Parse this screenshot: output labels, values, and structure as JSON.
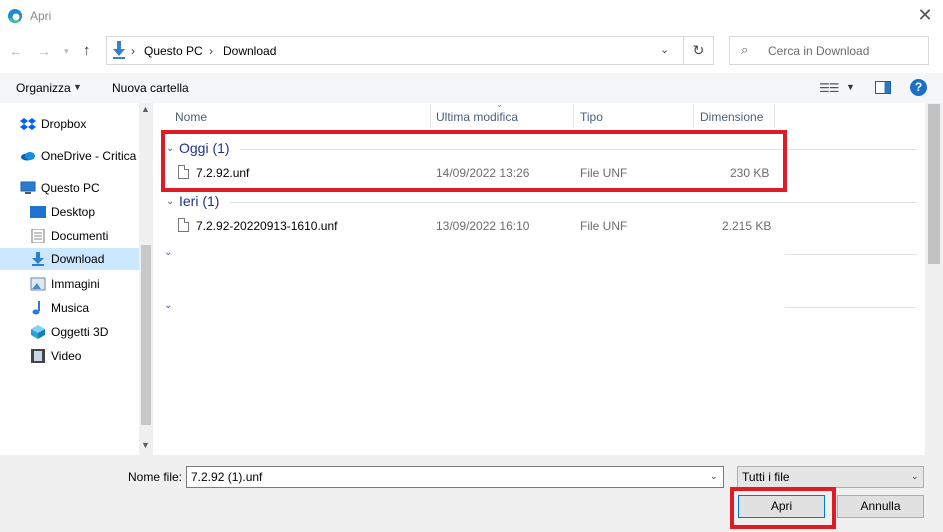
{
  "window": {
    "title": "Apri"
  },
  "address": {
    "segments": [
      "Questo PC",
      "Download"
    ],
    "separator": "›"
  },
  "search": {
    "placeholder": "Cerca in Download"
  },
  "toolbar": {
    "organize": "Organizza",
    "new_folder": "Nuova cartella"
  },
  "nav": {
    "items": [
      {
        "label": "Dropbox",
        "icon": "dropbox-icon"
      },
      {
        "label": "OneDrive - Critica",
        "icon": "onedrive-icon"
      },
      {
        "label": "Questo PC",
        "icon": "computer-icon"
      },
      {
        "label": "Desktop",
        "icon": "desktop-icon"
      },
      {
        "label": "Documenti",
        "icon": "documents-icon"
      },
      {
        "label": "Download",
        "icon": "download-icon",
        "selected": true
      },
      {
        "label": "Immagini",
        "icon": "pictures-icon"
      },
      {
        "label": "Musica",
        "icon": "music-icon"
      },
      {
        "label": "Oggetti 3D",
        "icon": "objects-3d-icon"
      },
      {
        "label": "Video",
        "icon": "video-icon"
      }
    ]
  },
  "columns": {
    "name": "Nome",
    "modified": "Ultima modifica",
    "type": "Tipo",
    "size": "Dimensione"
  },
  "groups": [
    {
      "header": "Oggi (1)",
      "files": [
        {
          "name": "7.2.92.unf",
          "modified": "14/09/2022 13:26",
          "type": "File UNF",
          "size": "230 KB"
        }
      ]
    },
    {
      "header": "Ieri (1)",
      "files": [
        {
          "name": "7.2.92-20220913-1610.unf",
          "modified": "13/09/2022 16:10",
          "type": "File UNF",
          "size": "2.215 KB"
        }
      ]
    }
  ],
  "bottom": {
    "filename_label": "Nome file:",
    "filename_value": "7.2.92 (1).unf",
    "filter_value": "Tutti i file",
    "open_label": "Apri",
    "cancel_label": "Annulla"
  },
  "colors": {
    "highlight": "#e01b24",
    "accent": "#0078d7",
    "group_header": "#1e3287"
  }
}
